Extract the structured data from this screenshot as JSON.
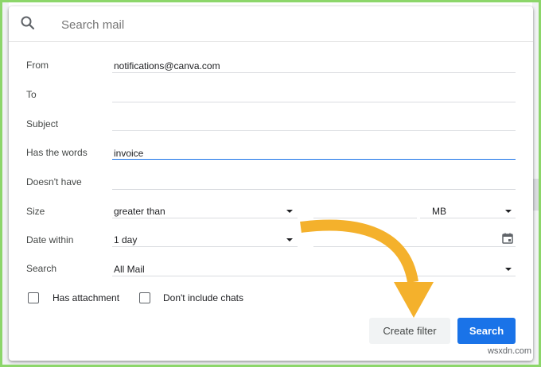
{
  "search": {
    "placeholder": "Search mail",
    "icon": "search-icon"
  },
  "fields": {
    "from": {
      "label": "From",
      "value": "notifications@canva.com"
    },
    "to": {
      "label": "To",
      "value": ""
    },
    "subject": {
      "label": "Subject",
      "value": ""
    },
    "has_words": {
      "label": "Has the words",
      "value": "invoice"
    },
    "doesnt_have": {
      "label": "Doesn't have",
      "value": ""
    },
    "size": {
      "label": "Size",
      "comparator": "greater than",
      "value": "",
      "unit": "MB"
    },
    "date_within": {
      "label": "Date within",
      "range": "1 day",
      "date": ""
    },
    "search_in": {
      "label": "Search",
      "value": "All Mail"
    }
  },
  "checkboxes": {
    "has_attachment": {
      "label": "Has attachment",
      "checked": false
    },
    "dont_include_chats": {
      "label": "Don't include chats",
      "checked": false
    }
  },
  "buttons": {
    "create_filter": "Create filter",
    "search": "Search"
  },
  "colors": {
    "accent": "#1a73e8",
    "arrow": "#f4b12c",
    "frame": "#8cd66a"
  },
  "watermark": "wsxdn.com"
}
